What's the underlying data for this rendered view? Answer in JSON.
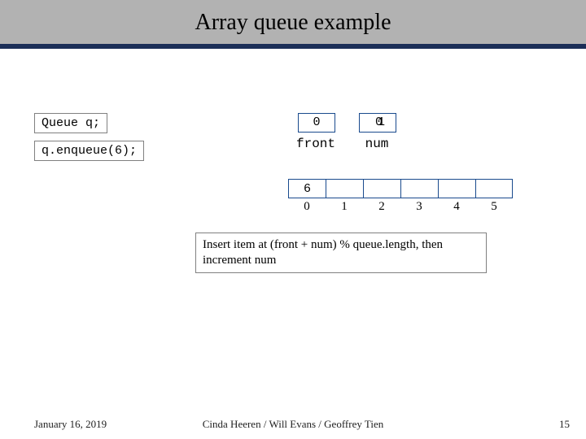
{
  "slide": {
    "title": "Array queue example",
    "code": {
      "line1": "Queue q;",
      "line2": "q.enqueue(6);"
    },
    "vars": {
      "front_value": "0",
      "front_label": "front",
      "num_value_a": "0",
      "num_value_b": "1",
      "num_label": "num"
    },
    "array": {
      "cells": [
        "6",
        "",
        "",
        "",
        "",
        ""
      ],
      "indices": [
        "0",
        "1",
        "2",
        "3",
        "4",
        "5"
      ]
    },
    "note": "Insert item at (front + num) % queue.length, then increment num",
    "footer": {
      "date": "January 16, 2019",
      "authors": "Cinda Heeren / Will Evans / Geoffrey Tien",
      "page": "15"
    }
  }
}
